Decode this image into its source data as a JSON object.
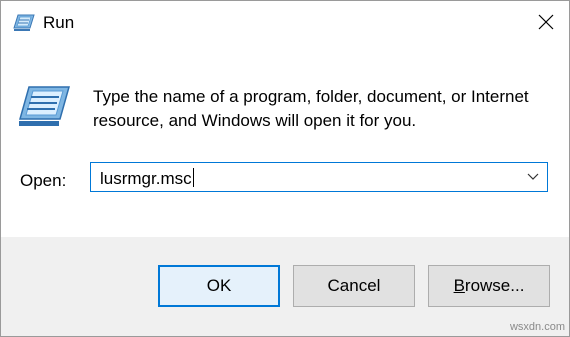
{
  "window": {
    "title": "Run",
    "app_icon": "run-icon",
    "close_icon": "close-icon"
  },
  "content": {
    "icon": "run-icon",
    "description": "Type the name of a program, folder, document, or Internet resource, and Windows will open it for you.",
    "open_label": "Open:",
    "open_value": "lusrmgr.msc",
    "dropdown_icon": "chevron-down-icon"
  },
  "buttons": {
    "ok": "OK",
    "cancel": "Cancel",
    "browse_mnemonic": "B",
    "browse_rest": "rowse..."
  },
  "watermark": "wsxdn.com",
  "colors": {
    "accent": "#0078d7",
    "footer_bg": "#f0f0f0",
    "button_bg": "#e1e1e1",
    "default_button_bg": "#e5f1fb"
  }
}
